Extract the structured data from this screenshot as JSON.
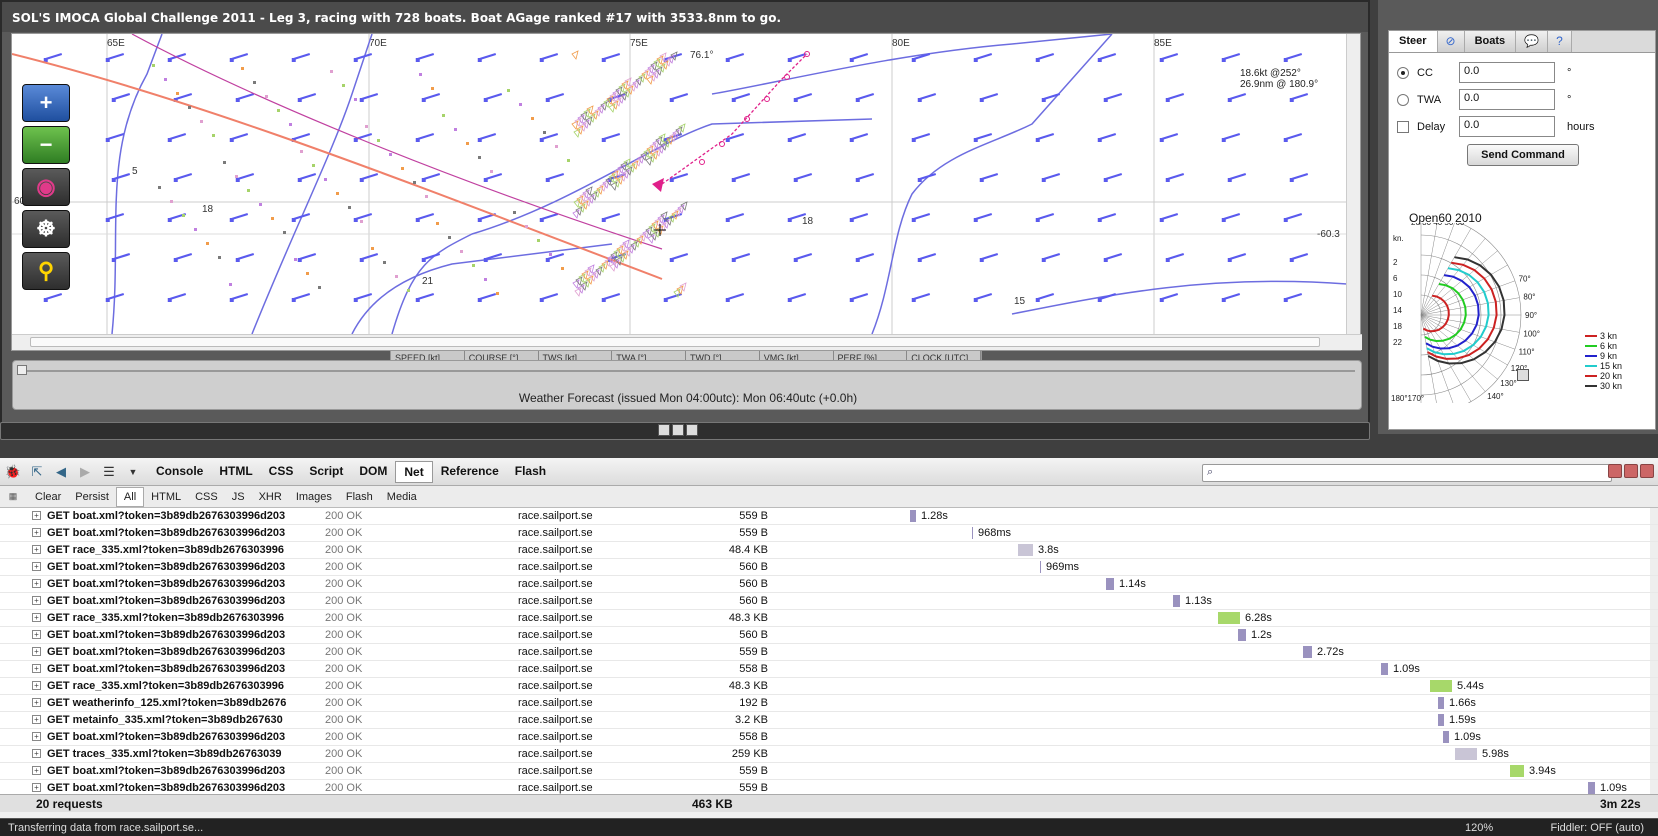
{
  "game": {
    "title": "SOL'S IMOCA Global Challenge 2011 - Leg 3, racing with 728 boats. Boat AGage ranked #17 with 3533.8nm to go.",
    "map": {
      "lon_labels": [
        "65E",
        "70E",
        "75E",
        "80E",
        "85E"
      ],
      "lat_label": "60S",
      "lat_right": "-60.3",
      "cursor_lon": "76.1°",
      "info1": "18.6kt @252°",
      "info2": "26.9nm @ 180.9°",
      "isobars": [
        "5",
        "18",
        "2",
        "21",
        "18",
        "15"
      ],
      "dashboard": [
        "SPEED [kt]",
        "COURSE [°]",
        "TWS [kt]",
        "TWA [°]",
        "TWD [°]",
        "VMG [kt]",
        "PERF [%]",
        "CLOCK [UTC]"
      ],
      "tools": [
        "zoom-in-icon",
        "zoom-out-icon",
        "center-boat-icon",
        "helm-icon",
        "compass-icon"
      ]
    },
    "forecast": "Weather Forecast  (issued Mon 04:00utc): Mon 06:40utc  (+0.0h)"
  },
  "steer": {
    "tabs": [
      "Steer",
      "Boats"
    ],
    "cc_label": "CC",
    "cc_value": "0.0",
    "cc_unit": "°",
    "twa_label": "TWA",
    "twa_value": "0.0",
    "twa_unit": "°",
    "delay_label": "Delay",
    "delay_value": "0.0",
    "delay_unit": "hours",
    "send": "Send Command",
    "polar_title": "Open60 2010",
    "polar_kn": "kn.",
    "polar_y": [
      "2",
      "6",
      "10",
      "14",
      "18",
      "22"
    ],
    "polar_angles_top": "20 30 40 50 60°",
    "polar_angles_right": [
      "70°",
      "80°",
      "90°",
      "100°",
      "110°",
      "120°",
      "130°",
      "140°",
      "150°",
      "160°"
    ],
    "polar_bottom": "180°170°",
    "legend": [
      {
        "label": "3 kn",
        "color": "#cc2222"
      },
      {
        "label": "6 kn",
        "color": "#22cc22"
      },
      {
        "label": "9 kn",
        "color": "#2222cc"
      },
      {
        "label": "15 kn",
        "color": "#22cccc"
      },
      {
        "label": "20 kn",
        "color": "#cc2222"
      },
      {
        "label": "30 kn",
        "color": "#333333"
      }
    ]
  },
  "firebug": {
    "panels": [
      "Console",
      "HTML",
      "CSS",
      "Script",
      "DOM",
      "Net",
      "Reference",
      "Flash"
    ],
    "active_panel": "Net",
    "sub": [
      "Clear",
      "Persist",
      "All",
      "HTML",
      "CSS",
      "JS",
      "XHR",
      "Images",
      "Flash",
      "Media"
    ],
    "active_sub": "All",
    "requests": [
      {
        "url": "GET boat.xml?token=3b89db2676303996d203",
        "status": "200 OK",
        "domain": "race.sailport.se",
        "size": "559 B",
        "time": "1.28s",
        "kind": "w"
      },
      {
        "url": "GET boat.xml?token=3b89db2676303996d203",
        "status": "200 OK",
        "domain": "race.sailport.se",
        "size": "559 B",
        "time": "968ms",
        "kind": "w"
      },
      {
        "url": "GET race_335.xml?token=3b89db2676303996",
        "status": "200 OK",
        "domain": "race.sailport.se",
        "size": "48.4 KB",
        "time": "3.8s",
        "kind": "r"
      },
      {
        "url": "GET boat.xml?token=3b89db2676303996d203",
        "status": "200 OK",
        "domain": "race.sailport.se",
        "size": "560 B",
        "time": "969ms",
        "kind": "w"
      },
      {
        "url": "GET boat.xml?token=3b89db2676303996d203",
        "status": "200 OK",
        "domain": "race.sailport.se",
        "size": "560 B",
        "time": "1.14s",
        "kind": "w"
      },
      {
        "url": "GET boat.xml?token=3b89db2676303996d203",
        "status": "200 OK",
        "domain": "race.sailport.se",
        "size": "560 B",
        "time": "1.13s",
        "kind": "w"
      },
      {
        "url": "GET race_335.xml?token=3b89db2676303996",
        "status": "200 OK",
        "domain": "race.sailport.se",
        "size": "48.3 KB",
        "time": "6.28s",
        "kind": "g"
      },
      {
        "url": "GET boat.xml?token=3b89db2676303996d203",
        "status": "200 OK",
        "domain": "race.sailport.se",
        "size": "560 B",
        "time": "1.2s",
        "kind": "w"
      },
      {
        "url": "GET boat.xml?token=3b89db2676303996d203",
        "status": "200 OK",
        "domain": "race.sailport.se",
        "size": "559 B",
        "time": "2.72s",
        "kind": "w"
      },
      {
        "url": "GET boat.xml?token=3b89db2676303996d203",
        "status": "200 OK",
        "domain": "race.sailport.se",
        "size": "558 B",
        "time": "1.09s",
        "kind": "w"
      },
      {
        "url": "GET race_335.xml?token=3b89db2676303996",
        "status": "200 OK",
        "domain": "race.sailport.se",
        "size": "48.3 KB",
        "time": "5.44s",
        "kind": "g"
      },
      {
        "url": "GET weatherinfo_125.xml?token=3b89db2676",
        "status": "200 OK",
        "domain": "race.sailport.se",
        "size": "192 B",
        "time": "1.66s",
        "kind": "w"
      },
      {
        "url": "GET metainfo_335.xml?token=3b89db267630",
        "status": "200 OK",
        "domain": "race.sailport.se",
        "size": "3.2 KB",
        "time": "1.59s",
        "kind": "w"
      },
      {
        "url": "GET boat.xml?token=3b89db2676303996d203",
        "status": "200 OK",
        "domain": "race.sailport.se",
        "size": "558 B",
        "time": "1.09s",
        "kind": "w"
      },
      {
        "url": "GET traces_335.xml?token=3b89db26763039",
        "status": "200 OK",
        "domain": "race.sailport.se",
        "size": "259 KB",
        "time": "5.98s",
        "kind": "r"
      },
      {
        "url": "GET boat.xml?token=3b89db2676303996d203",
        "status": "200 OK",
        "domain": "race.sailport.se",
        "size": "559 B",
        "time": "3.94s",
        "kind": "g"
      },
      {
        "url": "GET boat.xml?token=3b89db2676303996d203",
        "status": "200 OK",
        "domain": "race.sailport.se",
        "size": "559 B",
        "time": "1.09s",
        "kind": "w"
      }
    ],
    "summary_count": "20 requests",
    "summary_size": "463 KB",
    "summary_time": "3m 22s"
  },
  "status": {
    "left": "Transferring data from race.sailport.se...",
    "zoom": "120%",
    "fiddler": "Fiddler: OFF (auto)"
  }
}
